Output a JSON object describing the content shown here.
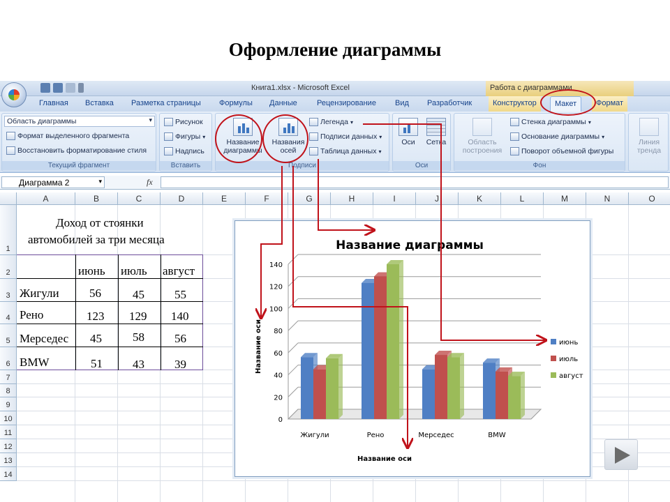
{
  "slide": {
    "title": "Оформление диаграммы"
  },
  "window": {
    "title": "Книга1.xlsx - Microsoft Excel",
    "context_title": "Работа с диаграммами"
  },
  "tabs": [
    "Главная",
    "Вставка",
    "Разметка страницы",
    "Формулы",
    "Данные",
    "Рецензирование",
    "Вид",
    "Разработчик",
    "Конструктор",
    "Макет",
    "Формат"
  ],
  "active_tab": "Макет",
  "ribbon": {
    "current_fragment": {
      "selector": "Область диаграммы",
      "format_selected": "Формат выделенного фрагмента",
      "restore_style": "Восстановить форматирование стиля",
      "label": "Текущий фрагмент"
    },
    "insert": {
      "picture": "Рисунок",
      "shapes": "Фигуры",
      "text_box": "Надпись",
      "label": "Вставить"
    },
    "labels": {
      "chart_title_l1": "Название",
      "chart_title_l2": "диаграммы",
      "axis_title_l1": "Названия",
      "axis_title_l2": "осей",
      "legend": "Легенда",
      "data_labels": "Подписи данных",
      "data_table": "Таблица данных",
      "label": "Подписи"
    },
    "axes": {
      "axes": "Оси",
      "gridlines": "Сетка",
      "label": "Оси"
    },
    "background": {
      "plot_area_l1": "Область",
      "plot_area_l2": "построения",
      "chart_wall": "Стенка диаграммы",
      "chart_floor": "Основание диаграммы",
      "rotation": "Поворот объемной фигуры",
      "label": "Фон"
    },
    "analysis": {
      "trendline_l1": "Линия",
      "trendline_l2": "тренда"
    }
  },
  "formula_bar": {
    "name_box": "Диаграмма 2",
    "fx": "fx"
  },
  "columns": [
    "A",
    "B",
    "C",
    "D",
    "E",
    "F",
    "G",
    "H",
    "I",
    "J",
    "K",
    "L",
    "M",
    "N",
    "O"
  ],
  "rows": [
    "1",
    "2",
    "3",
    "4",
    "5",
    "6",
    "7",
    "8",
    "9",
    "10",
    "11",
    "12",
    "13",
    "14"
  ],
  "table": {
    "title_l1": "Доход от стоянки",
    "title_l2": "автомобилей за три месяца",
    "headers": [
      "июнь",
      "июль",
      "август"
    ],
    "rows": [
      {
        "name": "Жигули",
        "values": [
          "56",
          "45",
          "55"
        ]
      },
      {
        "name": "Рено",
        "values": [
          "123",
          "129",
          "140"
        ]
      },
      {
        "name": "Мерседес",
        "values": [
          "45",
          "58",
          "56"
        ]
      },
      {
        "name": "BMW",
        "values": [
          "51",
          "43",
          "39"
        ]
      }
    ]
  },
  "chart_data": {
    "type": "bar",
    "title": "Название диаграммы",
    "xlabel": "Название оси",
    "ylabel": "Название оси",
    "categories": [
      "Жигули",
      "Рено",
      "Мерседес",
      "BMW"
    ],
    "series": [
      {
        "name": "июнь",
        "values": [
          56,
          123,
          45,
          51
        ],
        "color": "#4f7fc4"
      },
      {
        "name": "июль",
        "values": [
          45,
          129,
          58,
          43
        ],
        "color": "#c0504d"
      },
      {
        "name": "август",
        "values": [
          55,
          140,
          56,
          39
        ],
        "color": "#9bbb59"
      }
    ],
    "yticks": [
      "0",
      "20",
      "40",
      "60",
      "80",
      "100",
      "120",
      "140"
    ],
    "ylim": [
      0,
      140
    ],
    "grid": true,
    "legend": "right"
  },
  "colors": {
    "annotation": "#c0121a",
    "ribbon": "#dbe7f5"
  },
  "icons": {
    "nav": "play-icon"
  }
}
